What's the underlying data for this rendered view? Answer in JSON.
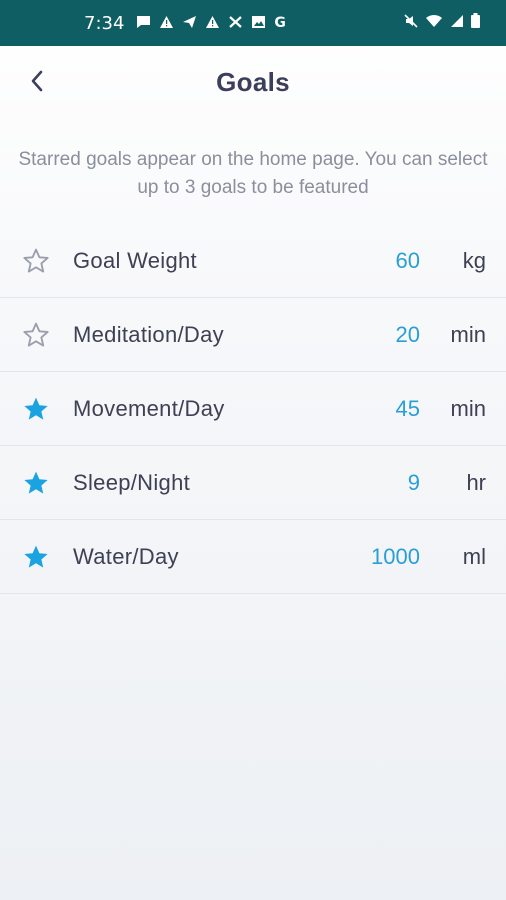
{
  "statusbar": {
    "time": "7:34",
    "left_icons": [
      "message-icon",
      "warning-icon",
      "send-icon",
      "warning-icon",
      "tools-icon",
      "image-icon",
      "google-icon"
    ],
    "google_letter": "G",
    "right_icons": [
      "mute-icon",
      "wifi-icon",
      "signal-icon",
      "battery-icon"
    ]
  },
  "header": {
    "title": "Goals",
    "back_icon": "back-chevron-icon"
  },
  "subtitle": "Starred goals appear on the home page. You can select up to 3 goals to be featured",
  "goals": [
    {
      "label": "Goal Weight",
      "value": "60",
      "unit": "kg",
      "starred": false
    },
    {
      "label": "Meditation/Day",
      "value": "20",
      "unit": "min",
      "starred": false
    },
    {
      "label": "Movement/Day",
      "value": "45",
      "unit": "min",
      "starred": true
    },
    {
      "label": "Sleep/Night",
      "value": "9",
      "unit": "hr",
      "starred": true
    },
    {
      "label": "Water/Day",
      "value": "1000",
      "unit": "ml",
      "starred": true
    }
  ],
  "colors": {
    "statusbar": "#0f5e63",
    "accent": "#2a9fd6",
    "star_filled": "#1aa3e0",
    "star_outline": "#9aa0ab",
    "title": "#3b3f5c"
  }
}
